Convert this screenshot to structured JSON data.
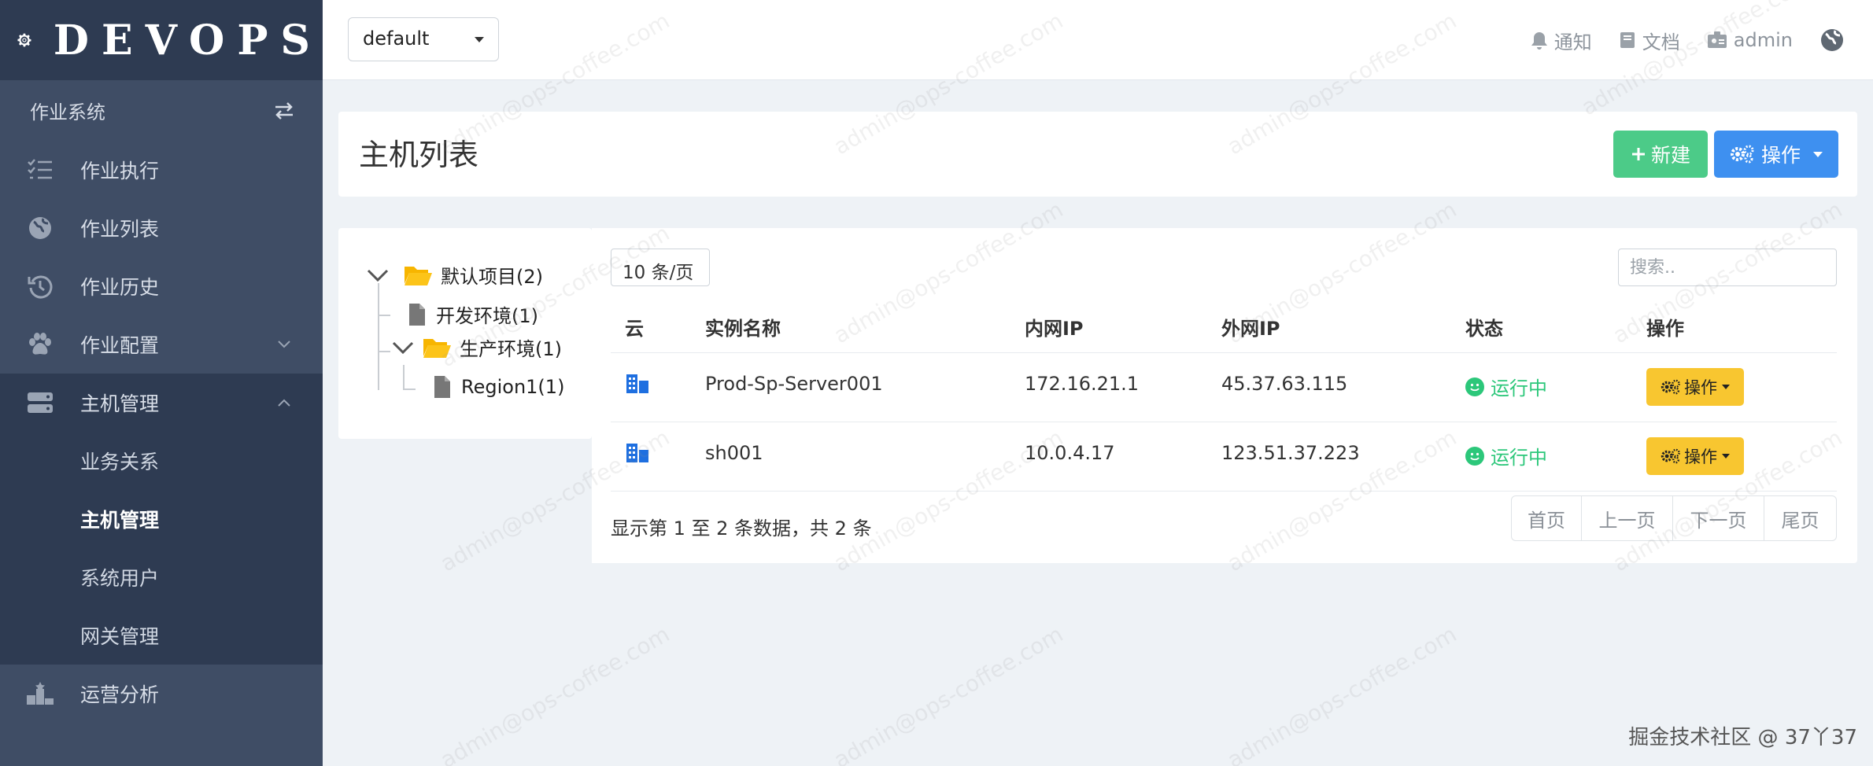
{
  "brand": {
    "name": "DEVOPS"
  },
  "sidebar": {
    "system_label": "作业系统",
    "items": [
      {
        "label": "作业执行",
        "icon": "task-list-icon"
      },
      {
        "label": "作业列表",
        "icon": "globe-icon"
      },
      {
        "label": "作业历史",
        "icon": "history-icon"
      },
      {
        "label": "作业配置",
        "icon": "paw-icon"
      },
      {
        "label": "主机管理",
        "icon": "server-icon"
      },
      {
        "label": "运营分析",
        "icon": "podium-icon"
      }
    ],
    "submenu": [
      "业务关系",
      "主机管理",
      "系统用户",
      "网关管理"
    ],
    "active_sub": "主机管理"
  },
  "header": {
    "env_select": "default",
    "notify": "通知",
    "docs": "文档",
    "user": "admin"
  },
  "page": {
    "title": "主机列表",
    "new_label": "新建",
    "op_label": "操作"
  },
  "tree": {
    "nodes": [
      "默认项目(2)",
      "开发环境(1)",
      "生产环境(1)",
      "Region1(1)"
    ]
  },
  "table": {
    "page_size": "10 条/页",
    "search_placeholder": "搜索..",
    "headers": [
      "云",
      "实例名称",
      "内网IP",
      "外网IP",
      "状态",
      "操作"
    ],
    "rows": [
      {
        "name": "Prod-Sp-Server001",
        "private_ip": "172.16.21.1",
        "public_ip": "45.37.63.115",
        "status": "运行中",
        "action": "操作"
      },
      {
        "name": "sh001",
        "private_ip": "10.0.4.17",
        "public_ip": "123.51.37.223",
        "status": "运行中",
        "action": "操作"
      }
    ],
    "summary": "显示第 1 至 2 条数据，共 2 条",
    "pager": [
      "首页",
      "上一页",
      "下一页",
      "尾页"
    ]
  },
  "watermark": "admin@ops-coffee.com",
  "footer": "掘金技术社区 @ 37丫37",
  "colors": {
    "sidebar": "#3f4d65",
    "sidebar_dark": "#2e3b52",
    "success": "#4ccb88",
    "primary": "#3e90f0",
    "warning": "#f8c630",
    "running": "#2cc77a"
  }
}
